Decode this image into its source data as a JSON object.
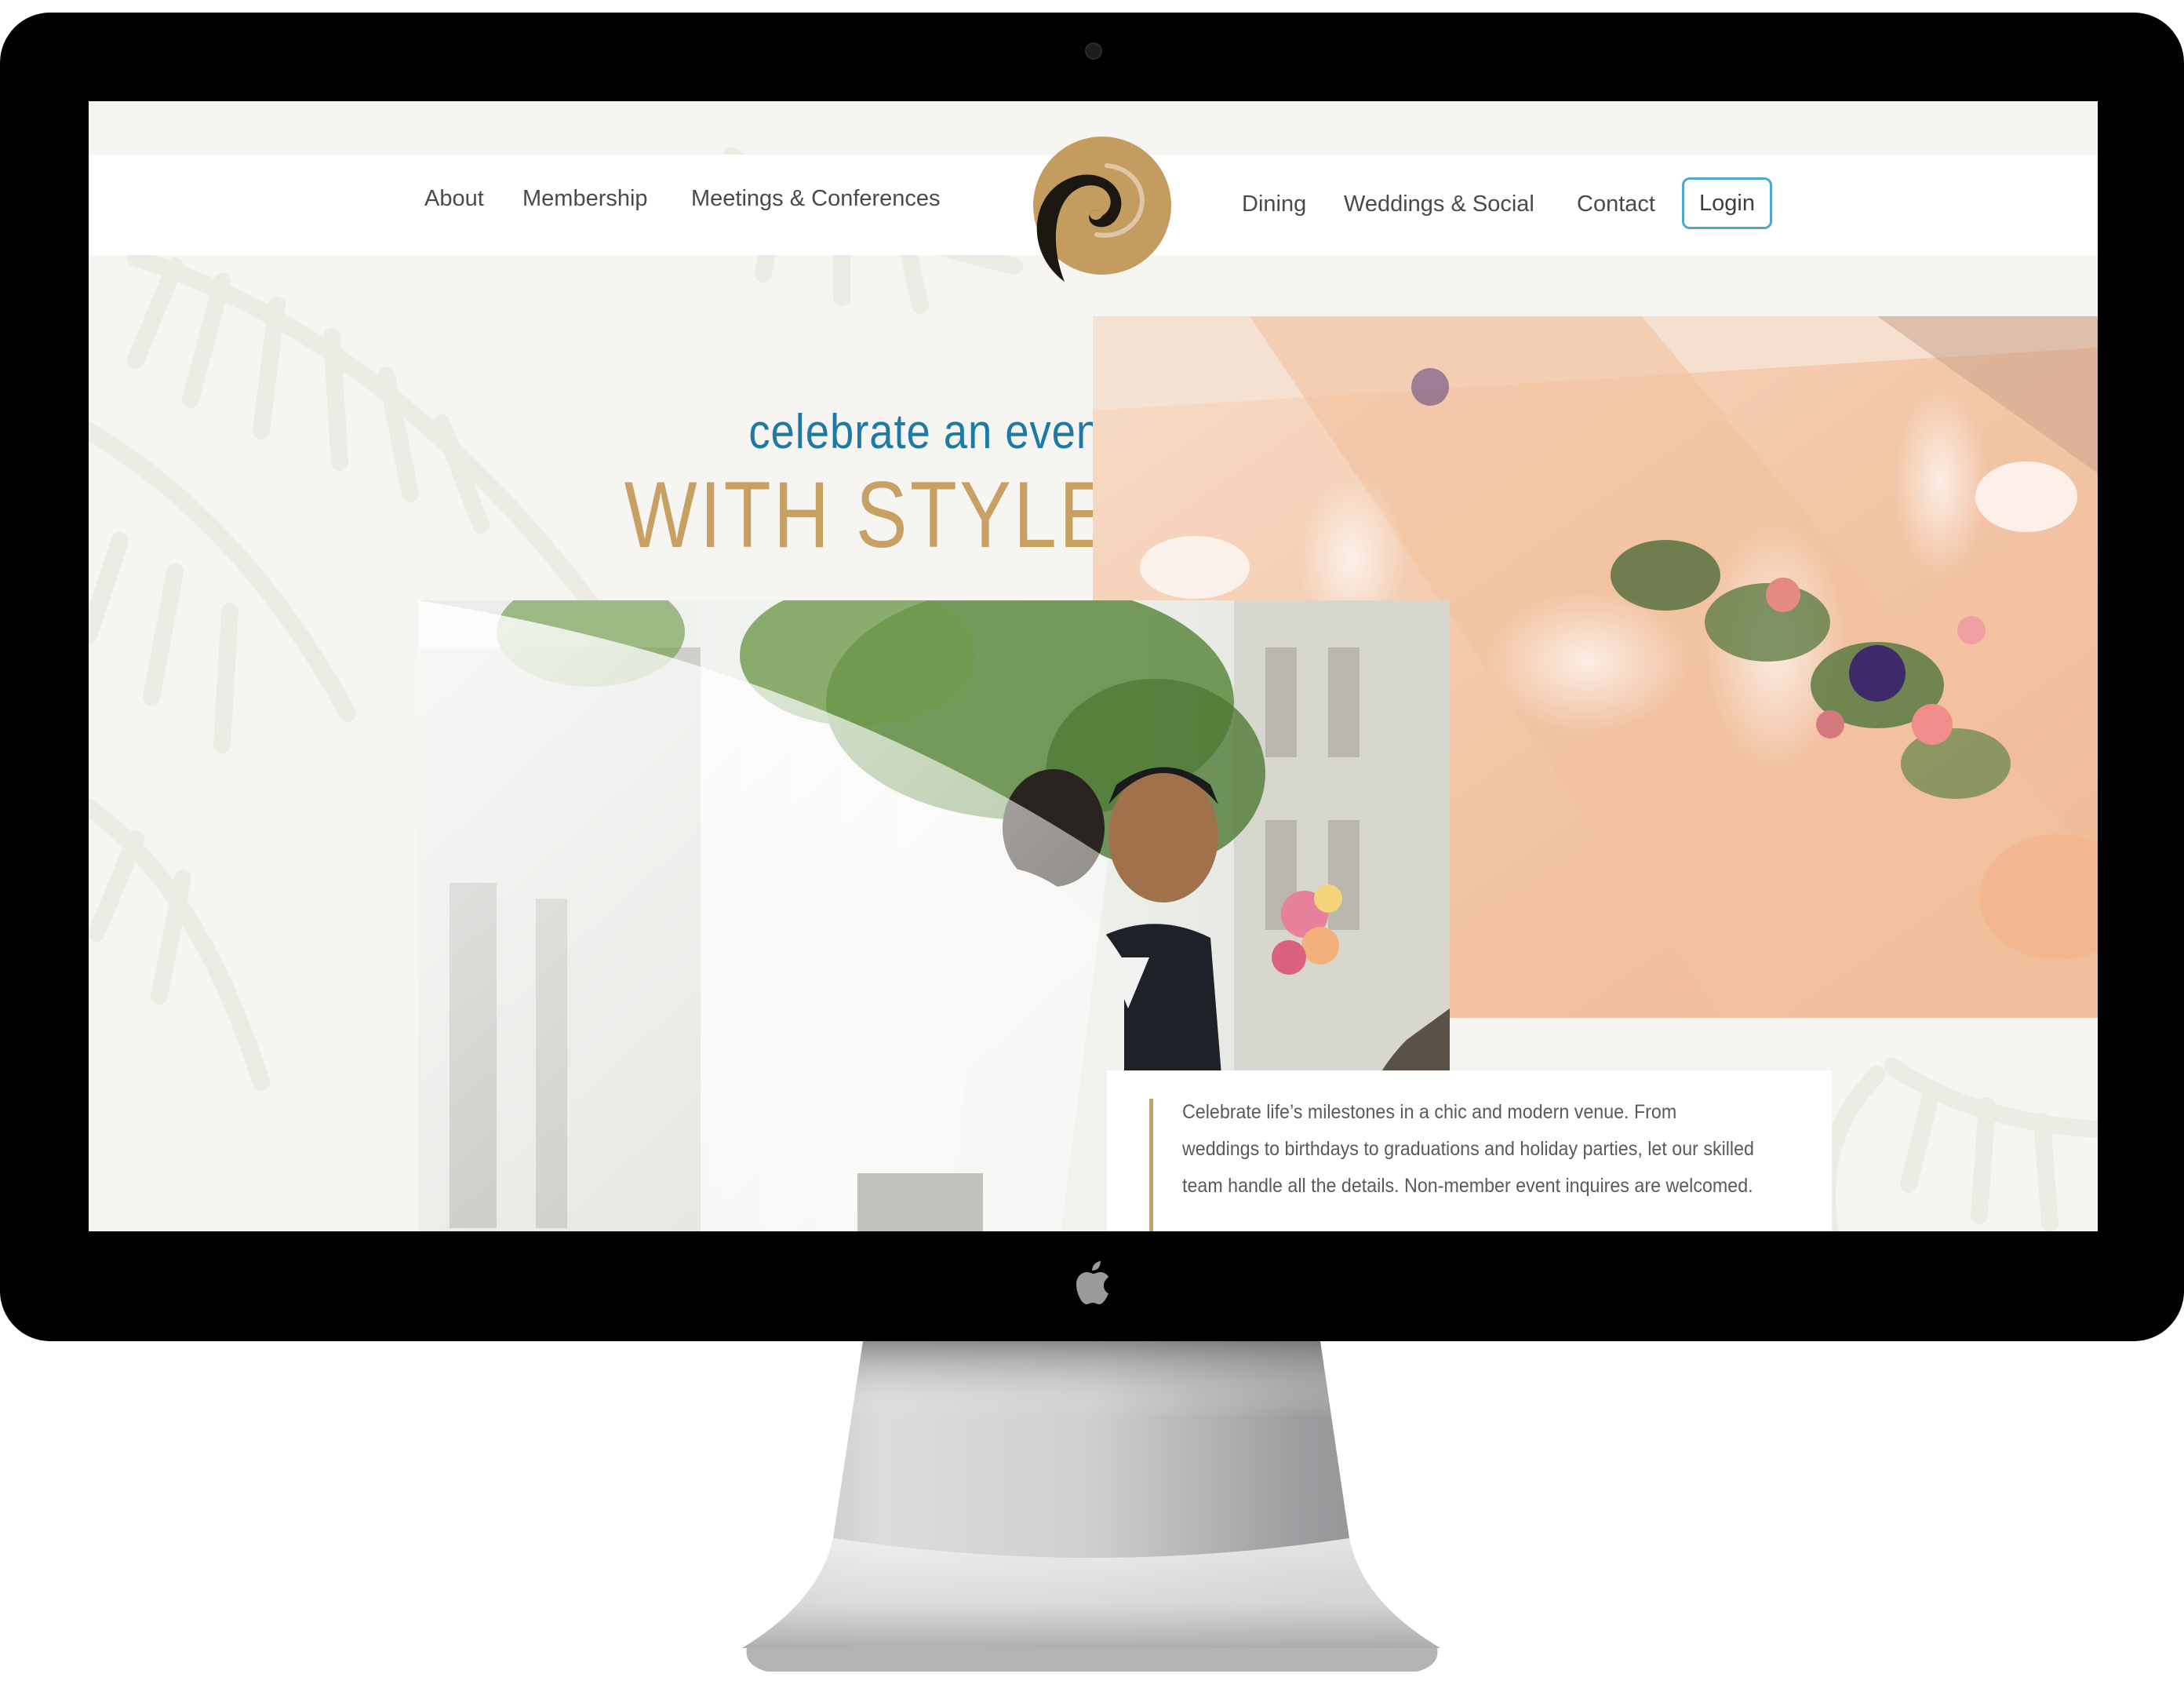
{
  "nav": {
    "left_items": [
      "About",
      "Membership",
      "Meetings & Conferences"
    ],
    "right_items": [
      "Dining",
      "Weddings & Social",
      "Contact"
    ],
    "login_label": "Login"
  },
  "hero": {
    "tagline": "celebrate an event",
    "headline": "WITH STYLE"
  },
  "intro": {
    "text": "Celebrate life’s milestones in a chic and modern venue. From weddings to birthdays to graduations and holiday parties, let our skilled team handle all the details. Non-member event inquires are welcomed."
  },
  "colors": {
    "accent_gold": "#c9a064",
    "accent_blue": "#1d7aa4",
    "login_border": "#4fa7cc"
  },
  "icons": {
    "logo": "swirl-logo-icon",
    "device_logo": "apple-icon"
  }
}
